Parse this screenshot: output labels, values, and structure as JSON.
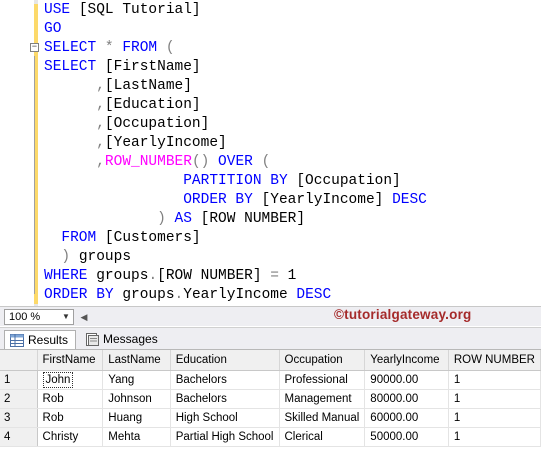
{
  "editor": {
    "lines": [
      [
        {
          "t": "USE ",
          "c": "kw"
        },
        {
          "t": "[SQL Tutorial]",
          "c": ""
        }
      ],
      [
        {
          "t": "GO",
          "c": "kw"
        }
      ],
      [
        {
          "t": "SELECT ",
          "c": "kw"
        },
        {
          "t": "* ",
          "c": "op"
        },
        {
          "t": "FROM ",
          "c": "kw"
        },
        {
          "t": "(",
          "c": "op"
        }
      ],
      [
        {
          "t": "SELECT ",
          "c": "kw"
        },
        {
          "t": "[FirstName]",
          "c": ""
        }
      ],
      [
        {
          "t": "      ,",
          "c": "op"
        },
        {
          "t": "[LastName]",
          "c": ""
        }
      ],
      [
        {
          "t": "      ,",
          "c": "op"
        },
        {
          "t": "[Education]",
          "c": ""
        }
      ],
      [
        {
          "t": "      ,",
          "c": "op"
        },
        {
          "t": "[Occupation]",
          "c": ""
        }
      ],
      [
        {
          "t": "      ,",
          "c": "op"
        },
        {
          "t": "[YearlyIncome]",
          "c": ""
        }
      ],
      [
        {
          "t": "      ,",
          "c": "op"
        },
        {
          "t": "ROW_NUMBER",
          "c": "fn"
        },
        {
          "t": "() ",
          "c": "op"
        },
        {
          "t": "OVER ",
          "c": "kw"
        },
        {
          "t": "(",
          "c": "op"
        }
      ],
      [
        {
          "t": "                PARTITION BY ",
          "c": "kw"
        },
        {
          "t": "[Occupation]",
          "c": ""
        }
      ],
      [
        {
          "t": "                ORDER BY ",
          "c": "kw"
        },
        {
          "t": "[YearlyIncome] ",
          "c": ""
        },
        {
          "t": "DESC",
          "c": "kw"
        }
      ],
      [
        {
          "t": "             ) ",
          "c": "op"
        },
        {
          "t": "AS ",
          "c": "kw"
        },
        {
          "t": "[ROW NUMBER]",
          "c": ""
        }
      ],
      [
        {
          "t": "  FROM ",
          "c": "kw"
        },
        {
          "t": "[Customers]",
          "c": ""
        }
      ],
      [
        {
          "t": "  ) ",
          "c": "op"
        },
        {
          "t": "groups",
          "c": ""
        }
      ],
      [
        {
          "t": "WHERE ",
          "c": "kw"
        },
        {
          "t": "groups",
          "c": ""
        },
        {
          "t": ".",
          "c": "op"
        },
        {
          "t": "[ROW NUMBER] ",
          "c": ""
        },
        {
          "t": "= ",
          "c": "op"
        },
        {
          "t": "1",
          "c": ""
        }
      ],
      [
        {
          "t": "ORDER BY ",
          "c": "kw"
        },
        {
          "t": "groups",
          "c": ""
        },
        {
          "t": ".",
          "c": "op"
        },
        {
          "t": "YearlyIncome ",
          "c": ""
        },
        {
          "t": "DESC",
          "c": "kw"
        }
      ]
    ]
  },
  "zoom": {
    "value": "100 %"
  },
  "watermark": "©tutorialgateway.org",
  "tabs": {
    "results": "Results",
    "messages": "Messages"
  },
  "grid": {
    "columns": [
      "FirstName",
      "LastName",
      "Education",
      "Occupation",
      "YearlyIncome",
      "ROW NUMBER"
    ],
    "rows": [
      {
        "num": "1",
        "cells": [
          "John",
          "Yang",
          "Bachelors",
          "Professional",
          "90000.00",
          "1"
        ]
      },
      {
        "num": "2",
        "cells": [
          "Rob",
          "Johnson",
          "Bachelors",
          "Management",
          "80000.00",
          "1"
        ]
      },
      {
        "num": "3",
        "cells": [
          "Rob",
          "Huang",
          "High School",
          "Skilled Manual",
          "60000.00",
          "1"
        ]
      },
      {
        "num": "4",
        "cells": [
          "Christy",
          "Mehta",
          "Partial High School",
          "Clerical",
          "50000.00",
          "1"
        ]
      }
    ]
  }
}
